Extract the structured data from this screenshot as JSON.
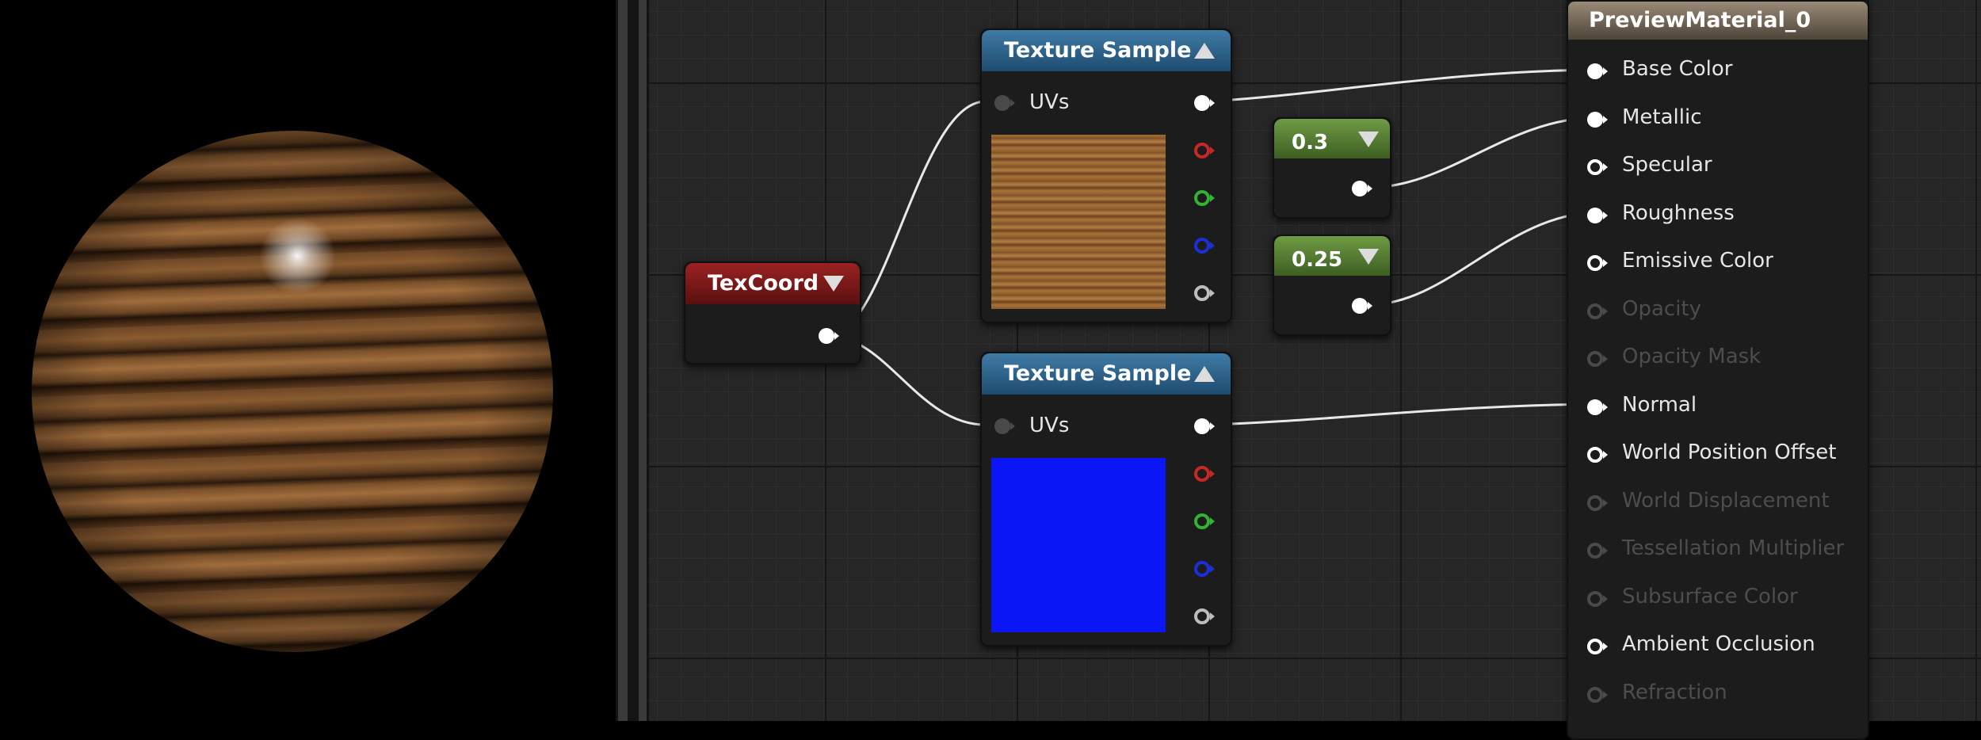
{
  "viewport": {
    "preview": "material-preview-sphere"
  },
  "nodes": {
    "texcoord": {
      "title": "TexCoord"
    },
    "texture_sample_1": {
      "title": "Texture Sample",
      "uvs_label": "UVs",
      "texture": "wood-diffuse"
    },
    "texture_sample_2": {
      "title": "Texture Sample",
      "uvs_label": "UVs",
      "texture": "normal-map"
    },
    "constant_1": {
      "value": "0.3"
    },
    "constant_2": {
      "value": "0.25"
    },
    "material": {
      "title": "PreviewMaterial_0",
      "inputs": [
        {
          "label": "Base Color",
          "connected": true,
          "enabled": true
        },
        {
          "label": "Metallic",
          "connected": true,
          "enabled": true
        },
        {
          "label": "Specular",
          "connected": false,
          "enabled": true
        },
        {
          "label": "Roughness",
          "connected": true,
          "enabled": true
        },
        {
          "label": "Emissive Color",
          "connected": false,
          "enabled": true
        },
        {
          "label": "Opacity",
          "connected": false,
          "enabled": false
        },
        {
          "label": "Opacity Mask",
          "connected": false,
          "enabled": false
        },
        {
          "label": "Normal",
          "connected": true,
          "enabled": true
        },
        {
          "label": "World Position Offset",
          "connected": false,
          "enabled": true
        },
        {
          "label": "World Displacement",
          "connected": false,
          "enabled": false
        },
        {
          "label": "Tessellation Multiplier",
          "connected": false,
          "enabled": false
        },
        {
          "label": "Subsurface Color",
          "connected": false,
          "enabled": false
        },
        {
          "label": "Ambient Occlusion",
          "connected": false,
          "enabled": true
        },
        {
          "label": "Refraction",
          "connected": false,
          "enabled": false
        }
      ]
    }
  },
  "colors": {
    "pin_white": "#ffffff",
    "pin_red": "#c62828",
    "pin_green": "#33b233",
    "pin_blue": "#1c2fd6",
    "pin_gray": "#bdbdbd",
    "pin_dim": "#4a4a4a",
    "wire": "#e8e8e8"
  }
}
